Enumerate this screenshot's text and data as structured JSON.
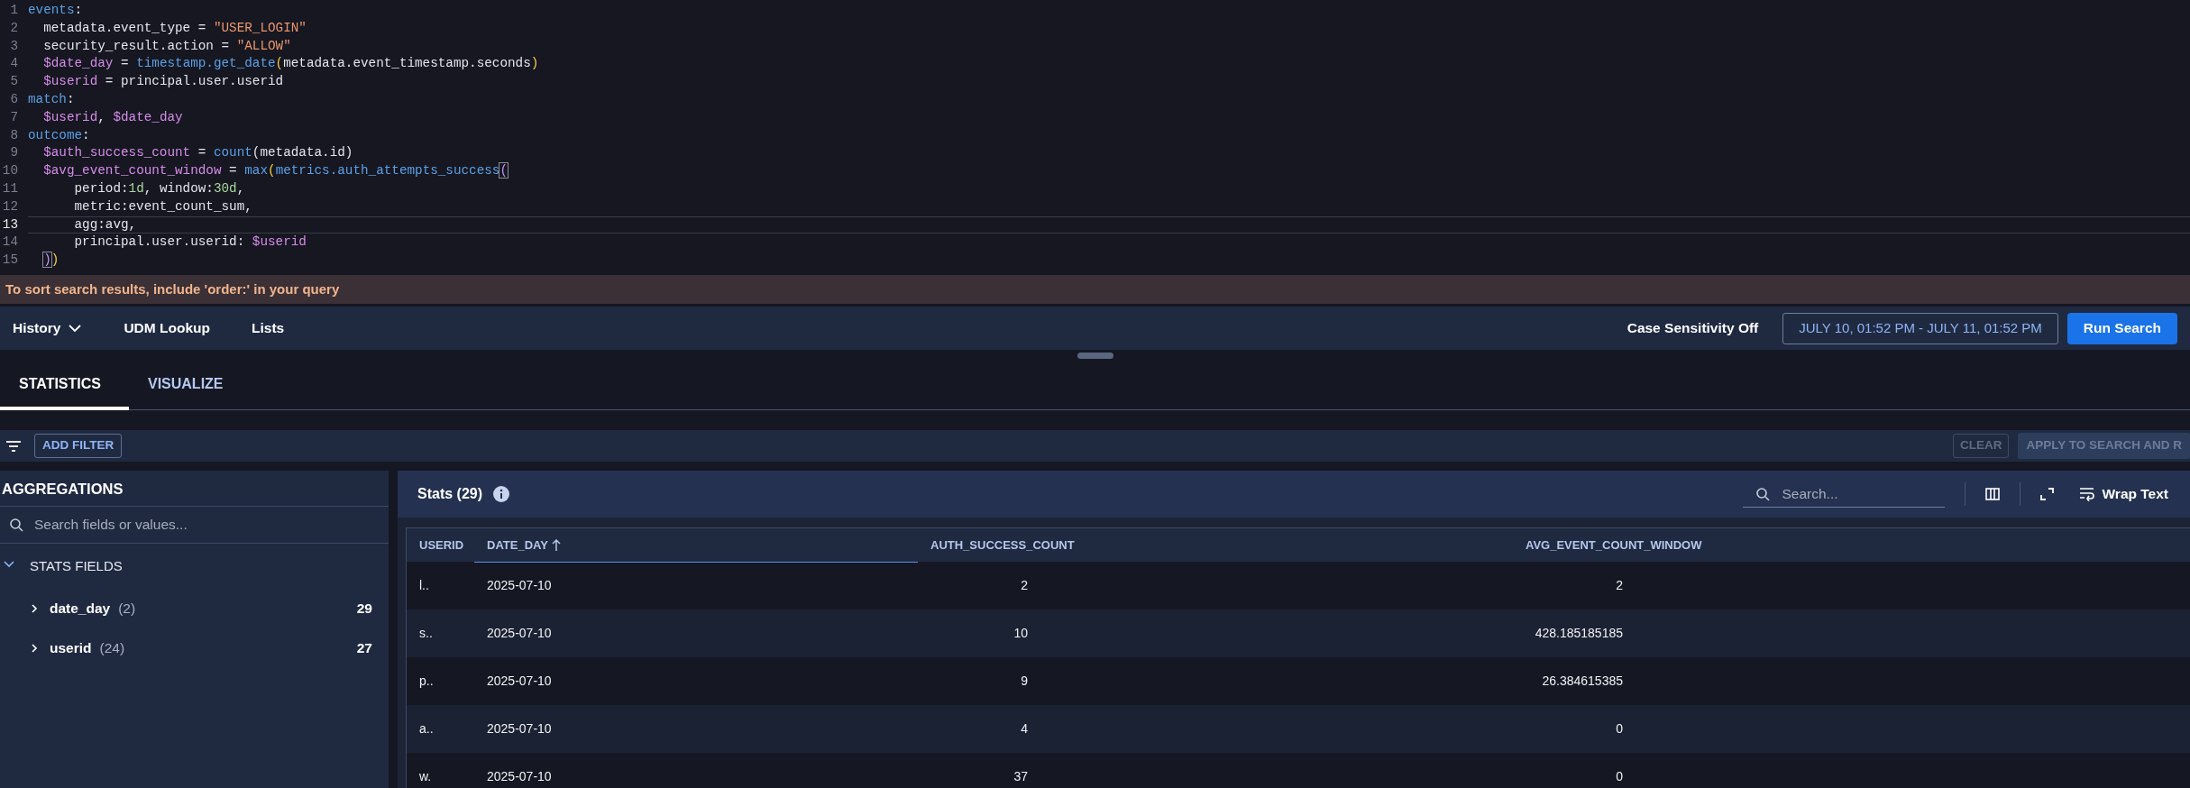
{
  "editor": {
    "lines": [
      {
        "number": "1",
        "current": false,
        "tokens": [
          {
            "kind": "keyword",
            "text": "events"
          },
          {
            "kind": "plain",
            "text": ":"
          }
        ]
      },
      {
        "number": "2",
        "current": false,
        "tokens": [
          {
            "kind": "plain",
            "text": "  metadata.event_type = "
          },
          {
            "kind": "string",
            "text": "\"USER_LOGIN\""
          }
        ]
      },
      {
        "number": "3",
        "current": false,
        "tokens": [
          {
            "kind": "plain",
            "text": "  security_result.action = "
          },
          {
            "kind": "string",
            "text": "\"ALLOW\""
          }
        ]
      },
      {
        "number": "4",
        "current": false,
        "tokens": [
          {
            "kind": "variable",
            "text": "  $date_day"
          },
          {
            "kind": "plain",
            "text": " = "
          },
          {
            "kind": "function",
            "text": "timestamp.get_date"
          },
          {
            "kind": "bracket",
            "text": "("
          },
          {
            "kind": "plain",
            "text": "metadata.event_timestamp.seconds"
          },
          {
            "kind": "bracket",
            "text": ")"
          }
        ]
      },
      {
        "number": "5",
        "current": false,
        "tokens": [
          {
            "kind": "variable",
            "text": "  $userid"
          },
          {
            "kind": "plain",
            "text": " = principal.user.userid"
          }
        ]
      },
      {
        "number": "6",
        "current": false,
        "tokens": [
          {
            "kind": "keyword",
            "text": "match"
          },
          {
            "kind": "plain",
            "text": ":"
          }
        ]
      },
      {
        "number": "7",
        "current": false,
        "tokens": [
          {
            "kind": "variable",
            "text": "  $userid"
          },
          {
            "kind": "plain",
            "text": ", "
          },
          {
            "kind": "variable",
            "text": "$date_day"
          }
        ]
      },
      {
        "number": "8",
        "current": false,
        "tokens": [
          {
            "kind": "keyword",
            "text": "outcome"
          },
          {
            "kind": "plain",
            "text": ":"
          }
        ]
      },
      {
        "number": "9",
        "current": false,
        "tokens": [
          {
            "kind": "variable",
            "text": "  $auth_success_count"
          },
          {
            "kind": "plain",
            "text": " = "
          },
          {
            "kind": "function",
            "text": "count"
          },
          {
            "kind": "plain",
            "text": "(metadata.id)"
          }
        ]
      },
      {
        "number": "10",
        "current": false,
        "tokens": [
          {
            "kind": "variable",
            "text": "  $avg_event_count_window"
          },
          {
            "kind": "plain",
            "text": " = "
          },
          {
            "kind": "function",
            "text": "max"
          },
          {
            "kind": "bracket",
            "text": "("
          },
          {
            "kind": "function",
            "text": "metrics.auth_attempts_success"
          },
          {
            "kind": "matched",
            "text": "("
          }
        ]
      },
      {
        "number": "11",
        "current": false,
        "tokens": [
          {
            "kind": "plain",
            "text": "      period:"
          },
          {
            "kind": "number",
            "text": "1d"
          },
          {
            "kind": "plain",
            "text": ", window:"
          },
          {
            "kind": "number",
            "text": "30d"
          },
          {
            "kind": "plain",
            "text": ","
          }
        ]
      },
      {
        "number": "12",
        "current": false,
        "tokens": [
          {
            "kind": "plain",
            "text": "      metric:event_count_sum,"
          }
        ]
      },
      {
        "number": "13",
        "current": true,
        "tokens": [
          {
            "kind": "plain",
            "text": "      agg:avg,"
          }
        ]
      },
      {
        "number": "14",
        "current": false,
        "tokens": [
          {
            "kind": "plain",
            "text": "      principal.user.userid: "
          },
          {
            "kind": "variable",
            "text": "$userid"
          }
        ]
      },
      {
        "number": "15",
        "current": false,
        "tokens": [
          {
            "kind": "matched",
            "text": "  )"
          },
          {
            "kind": "bracket",
            "text": ")"
          }
        ]
      }
    ]
  },
  "hint": "To sort search results, include 'order:' in your query",
  "toolbar": {
    "menus": [
      {
        "label": "History",
        "dropdown": true
      },
      {
        "label": "UDM Lookup",
        "dropdown": false
      },
      {
        "label": "Lists",
        "dropdown": false
      }
    ],
    "case_sensitivity": "Case Sensitivity Off",
    "time_range": "JULY 10, 01:52 PM - JULY 11, 01:52 PM",
    "run_button": "Run Search"
  },
  "tabs": [
    {
      "label": "STATISTICS",
      "selected": true
    },
    {
      "label": "VISUALIZE",
      "selected": false
    }
  ],
  "filter_bar": {
    "add_filter": "ADD FILTER",
    "clear": {
      "label": "CLEAR",
      "disabled": true
    },
    "apply": {
      "label": "APPLY TO SEARCH AND R",
      "disabled": true
    }
  },
  "aggregations": {
    "title": "AGGREGATIONS",
    "search": {
      "placeholder": "Search fields or values..."
    },
    "sections": [
      {
        "label": "STATS FIELDS",
        "expanded": true,
        "fields": [
          {
            "name": "date_day",
            "distinct": "(2)",
            "total": "29",
            "expanded": false
          },
          {
            "name": "userid",
            "distinct": "(24)",
            "total": "27",
            "expanded": false
          }
        ]
      }
    ]
  },
  "stats": {
    "title": "Stats (29)",
    "search": {
      "placeholder": "Search..."
    },
    "wrap_button": "Wrap Text",
    "table": {
      "columns": [
        {
          "label": "USERID",
          "sorted": false
        },
        {
          "label": "DATE_DAY",
          "sorted": true
        },
        {
          "label": "AUTH_SUCCESS_COUNT",
          "sorted": false
        },
        {
          "label": "AVG_EVENT_COUNT_WINDOW",
          "sorted": false
        }
      ],
      "rows": [
        [
          "l..",
          "2025-07-10",
          "2",
          "2"
        ],
        [
          "s..",
          "2025-07-10",
          "10",
          "428.185185185"
        ],
        [
          "p..",
          "2025-07-10",
          "9",
          "26.384615385"
        ],
        [
          "a..",
          "2025-07-10",
          "4",
          "0"
        ],
        [
          "w.",
          "2025-07-10",
          "37",
          "0"
        ]
      ]
    }
  }
}
